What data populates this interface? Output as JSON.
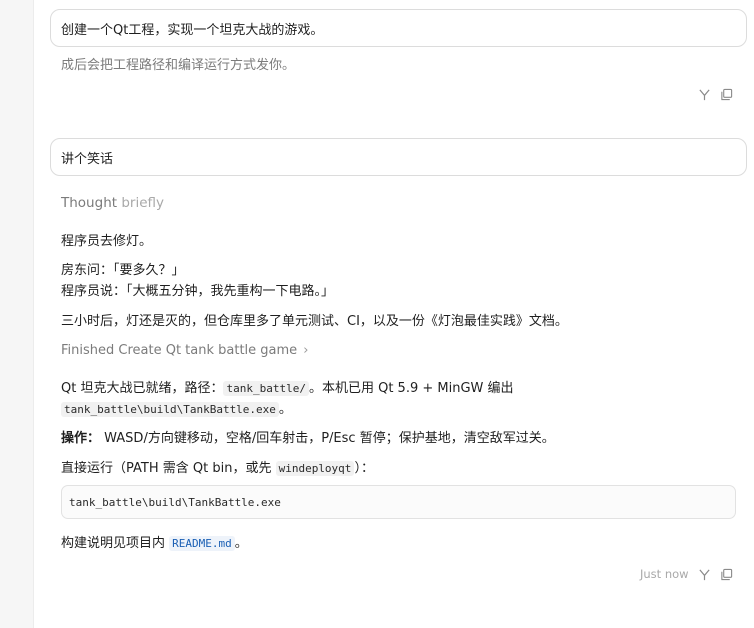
{
  "messages": {
    "first_prompt": "创建一个Qt工程，实现一个坦克大战的游戏。",
    "first_reply_line": "成后会把工程路径和编译运行方式发你。",
    "second_prompt": "讲个笑话",
    "thought_label": "Thought",
    "thought_duration": "briefly",
    "joke": {
      "line1": "程序员去修灯。",
      "line2": "房东问：「要多久？」",
      "line3": "程序员说：「大概五分钟，我先重构一下电路。」",
      "line4": "三小时后，灯还是灭的，但仓库里多了单元测试、CI，以及一份《灯泡最佳实践》文档。"
    },
    "task_status": "Finished Create Qt tank battle game",
    "result": {
      "line1_a": "Qt 坦克大战已就绪，路径：",
      "line1_code": "tank_battle/",
      "line1_b": "。本机已用 Qt 5.9 + MinGW 编出",
      "line2_code": "tank_battle\\build\\TankBattle.exe",
      "line2_b": "。",
      "controls_label": "操作：",
      "controls_text": " WASD/方向键移动，空格/回车射击，P/Esc 暂停；保护基地，清空敌军过关。",
      "run_a": "直接运行（PATH 需含 Qt bin，或先 ",
      "run_code": "windeployqt",
      "run_b": "）：",
      "code_block": "tank_battle\\build\\TankBattle.exe",
      "readme_a": "构建说明见项目内 ",
      "readme_code": "README.md",
      "readme_b": "。"
    },
    "timestamp": "Just now"
  },
  "icons": {
    "branch": "fork-icon",
    "copy": "copy-icon",
    "chevron": "chevron-right-icon"
  },
  "colors": {
    "border": "#dcdcdc",
    "muted": "#7b7b7b",
    "link": "#1a5fb4"
  }
}
